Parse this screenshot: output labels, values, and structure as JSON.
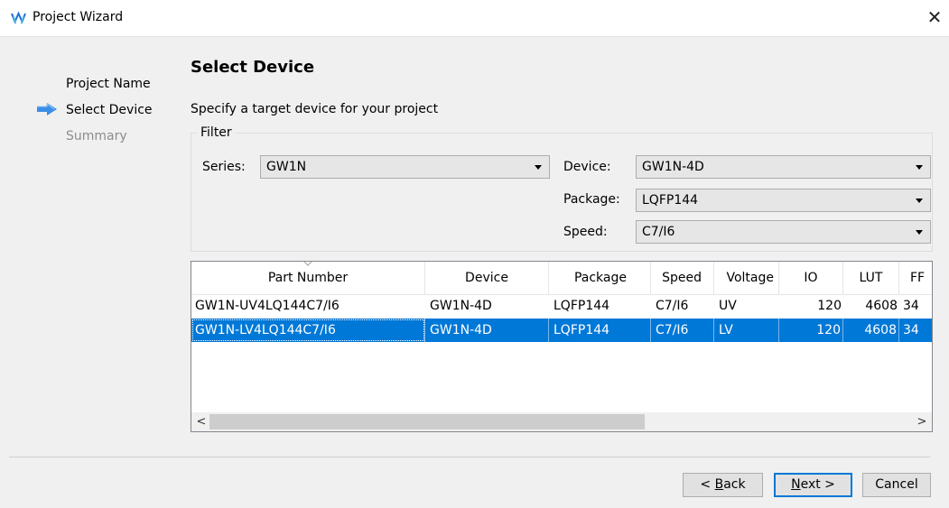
{
  "window": {
    "title": "Project Wizard",
    "close_glyph": "✕"
  },
  "steps": [
    {
      "label": "Project Name",
      "state": "done"
    },
    {
      "label": "Select Device",
      "state": "current"
    },
    {
      "label": "Summary",
      "state": "pending"
    }
  ],
  "page": {
    "heading": "Select Device",
    "description": "Specify a target device for your project"
  },
  "filter": {
    "legend": "Filter",
    "series_label": "Series:",
    "series_value": "GW1N",
    "device_label": "Device:",
    "device_value": "GW1N-4D",
    "package_label": "Package:",
    "package_value": "LQFP144",
    "speed_label": "Speed:",
    "speed_value": "C7/I6"
  },
  "table": {
    "columns": [
      "Part Number",
      "Device",
      "Package",
      "Speed",
      "Voltage",
      "IO",
      "LUT",
      "FF"
    ],
    "rows": [
      {
        "part": "GW1N-UV4LQ144C7/I6",
        "device": "GW1N-4D",
        "package": "LQFP144",
        "speed": "C7/I6",
        "voltage": "UV",
        "io": "120",
        "lut": "4608",
        "ff": "34",
        "selected": false
      },
      {
        "part": "GW1N-LV4LQ144C7/I6",
        "device": "GW1N-4D",
        "package": "LQFP144",
        "speed": "C7/I6",
        "voltage": "LV",
        "io": "120",
        "lut": "4608",
        "ff": "34",
        "selected": true
      }
    ]
  },
  "buttons": {
    "back_prefix": "< ",
    "back_mnemonic": "B",
    "back_rest": "ack",
    "next_mnemonic": "N",
    "next_rest": "ext >",
    "cancel": "Cancel"
  },
  "colors": {
    "accent": "#0078d7",
    "wizard_arrow": "#3c8ee6"
  },
  "icons": {
    "app": "gowin-logo-icon",
    "step_current": "arrow-right-icon"
  }
}
